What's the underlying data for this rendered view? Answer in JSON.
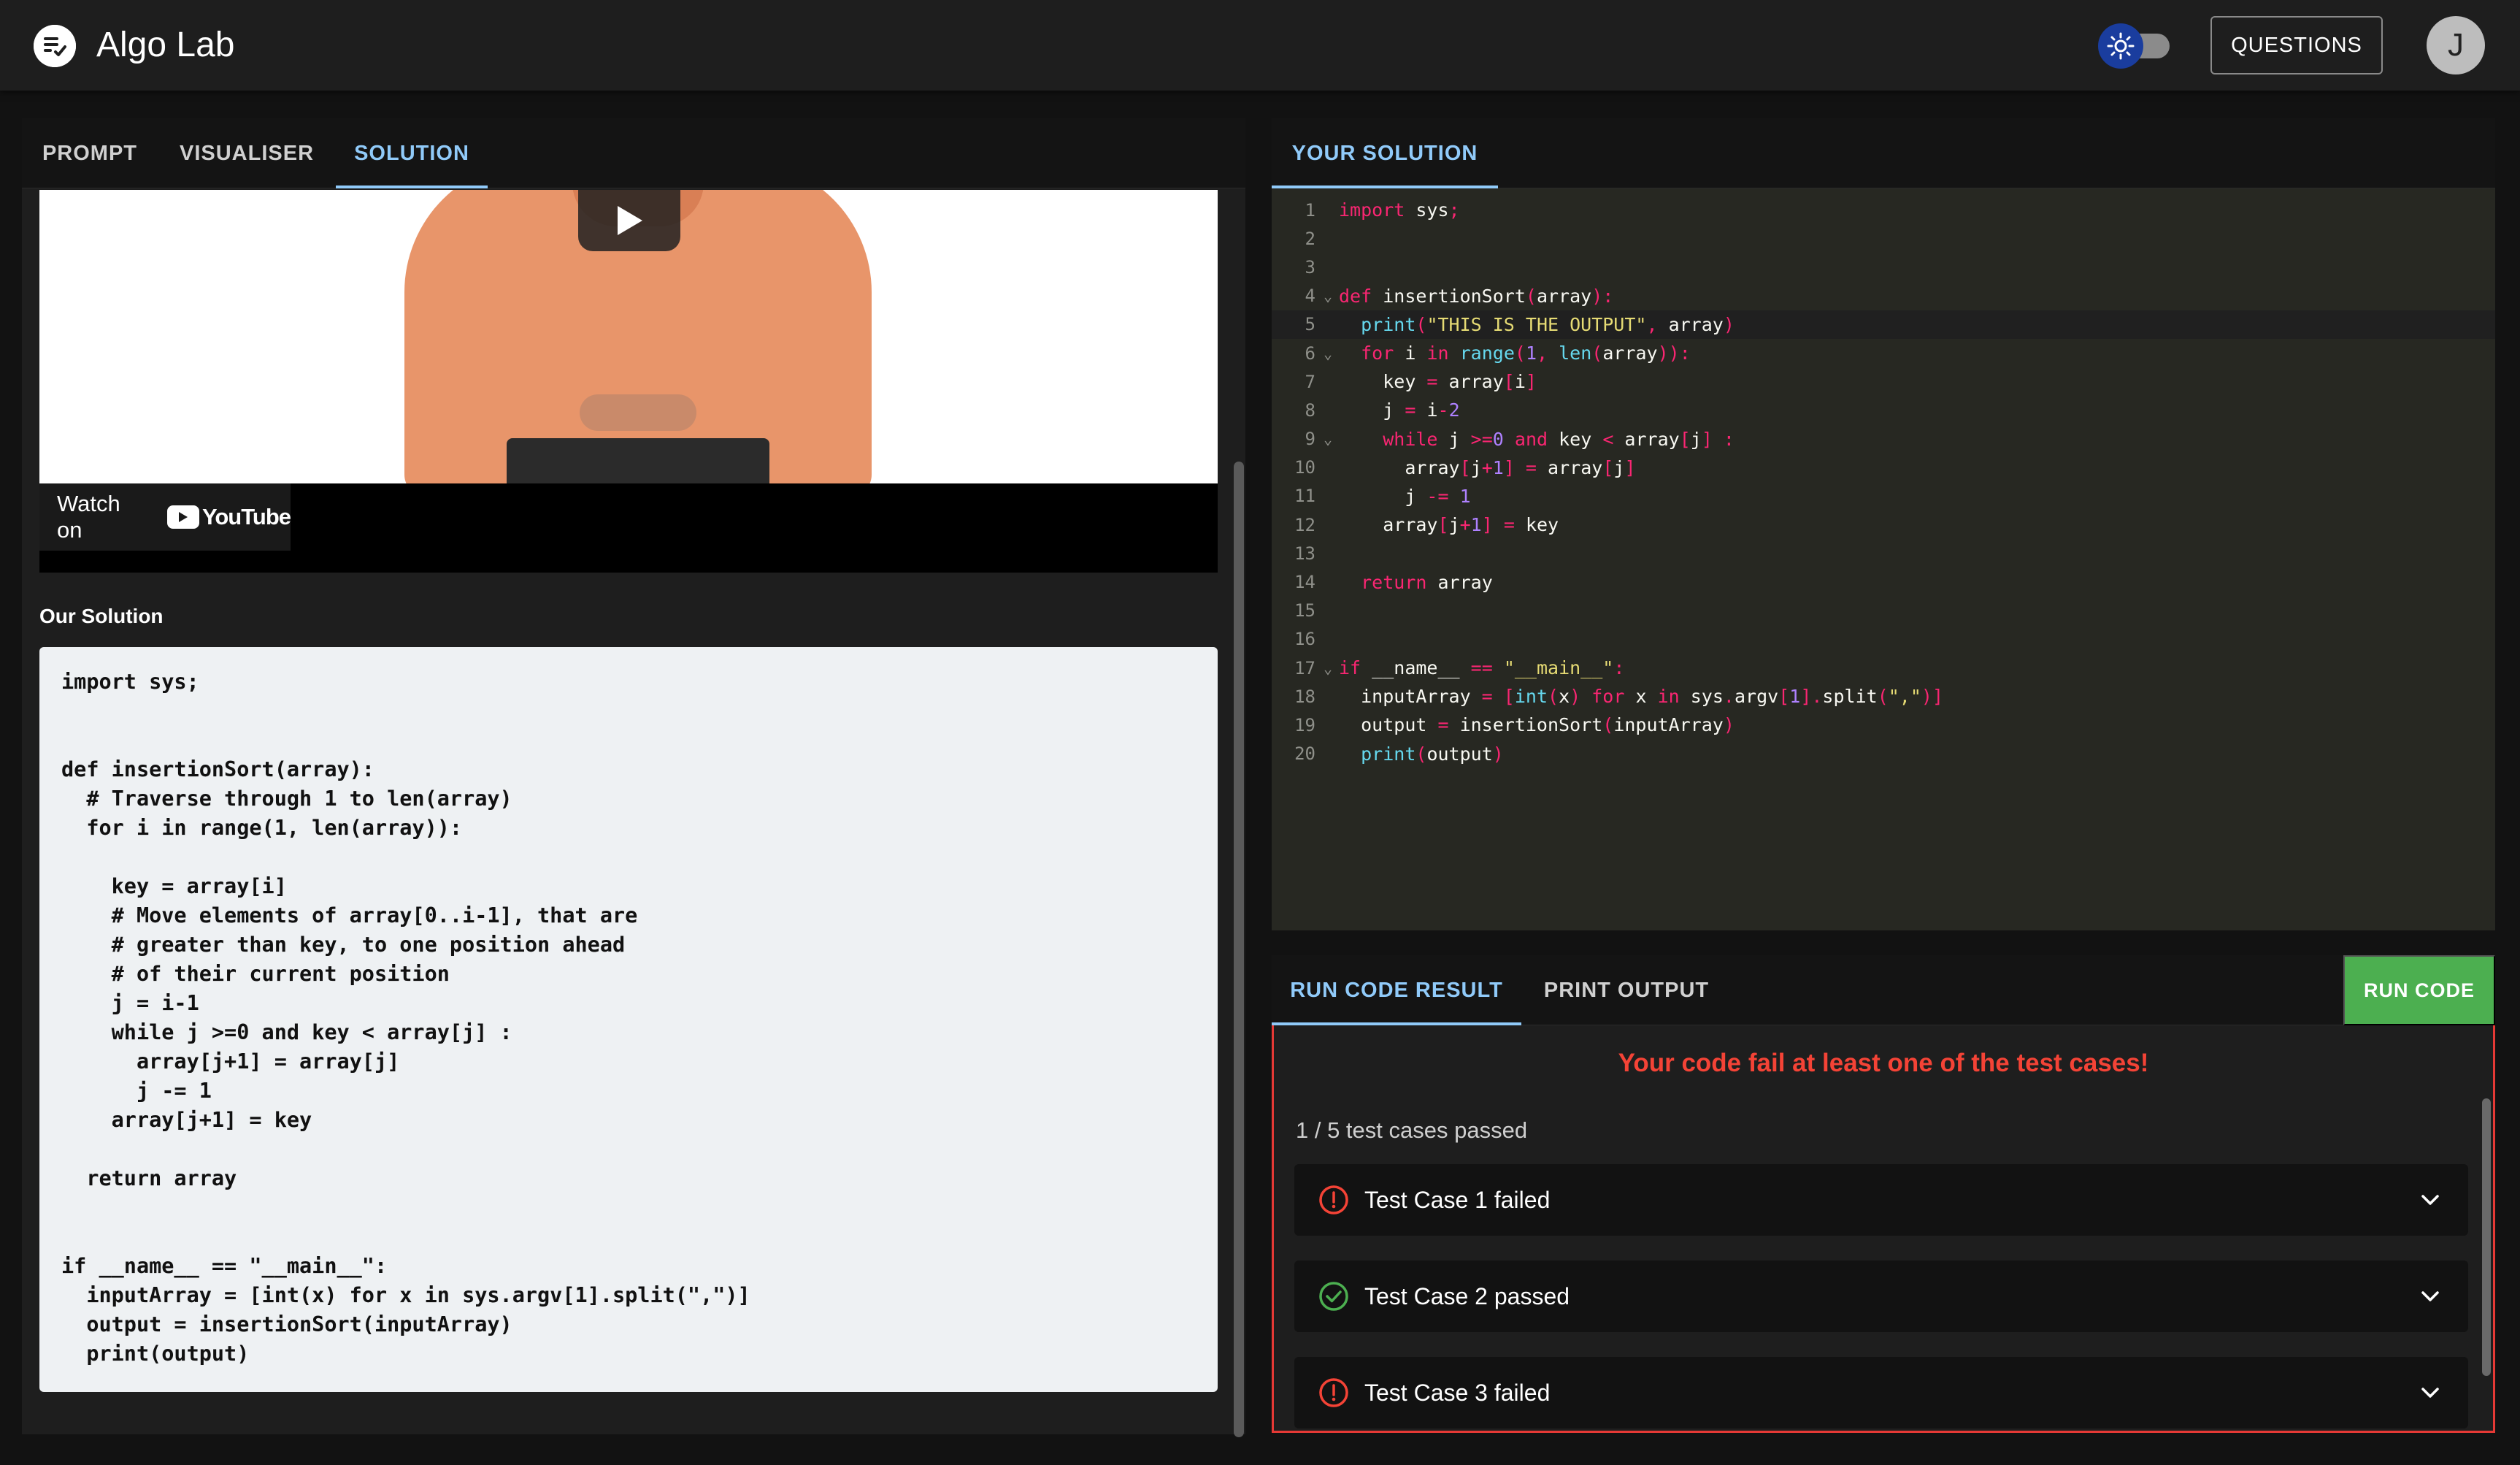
{
  "header": {
    "app_title": "Algo Lab",
    "questions_label": "QUESTIONS",
    "avatar_initial": "J",
    "theme_toggle_state": "dark"
  },
  "left_panel": {
    "tabs": [
      {
        "label": "PROMPT",
        "active": false
      },
      {
        "label": "VISUALISER",
        "active": false
      },
      {
        "label": "SOLUTION",
        "active": true
      }
    ],
    "video": {
      "watch_on_label": "Watch on",
      "platform_label": "YouTube"
    },
    "our_solution_heading": "Our Solution",
    "solution_code": "import sys;\n\n\ndef insertionSort(array):\n  # Traverse through 1 to len(array)\n  for i in range(1, len(array)):\n\n    key = array[i]\n    # Move elements of array[0..i-1], that are\n    # greater than key, to one position ahead\n    # of their current position\n    j = i-1\n    while j >=0 and key < array[j] :\n      array[j+1] = array[j]\n      j -= 1\n    array[j+1] = key\n\n  return array\n\n\nif __name__ == \"__main__\":\n  inputArray = [int(x) for x in sys.argv[1].split(\",\")]\n  output = insertionSort(inputArray)\n  print(output)"
  },
  "editor": {
    "tab_label": "YOUR SOLUTION",
    "lines": [
      "import sys;",
      "",
      "",
      "def insertionSort(array):",
      "  print(\"THIS IS THE OUTPUT\", array)",
      "  for i in range(1, len(array)):",
      "    key = array[i]",
      "    j = i-2",
      "    while j >=0 and key < array[j] :",
      "      array[j+1] = array[j]",
      "      j -= 1",
      "    array[j+1] = key",
      "",
      "  return array",
      "",
      "",
      "if __name__ == \"__main__\":",
      "  inputArray = [int(x) for x in sys.argv[1].split(\",\")]",
      "  output = insertionSort(inputArray)",
      "  print(output)"
    ],
    "fold_lines": [
      4,
      6,
      9,
      17
    ],
    "active_line": 5
  },
  "results": {
    "tabs": [
      {
        "label": "RUN CODE RESULT",
        "active": true
      },
      {
        "label": "PRINT OUTPUT",
        "active": false
      }
    ],
    "run_button_label": "RUN CODE",
    "fail_message": "Your code fail at least one of the test cases!",
    "pass_summary": "1 / 5 test cases passed",
    "test_cases": [
      {
        "label": "Test Case 1 failed",
        "status": "failed"
      },
      {
        "label": "Test Case 2 passed",
        "status": "passed"
      },
      {
        "label": "Test Case 3 failed",
        "status": "failed"
      }
    ]
  },
  "colors": {
    "accent": "#90caf9",
    "fail": "#f44336",
    "pass": "#4caf50",
    "run_button": "#4caf50"
  }
}
